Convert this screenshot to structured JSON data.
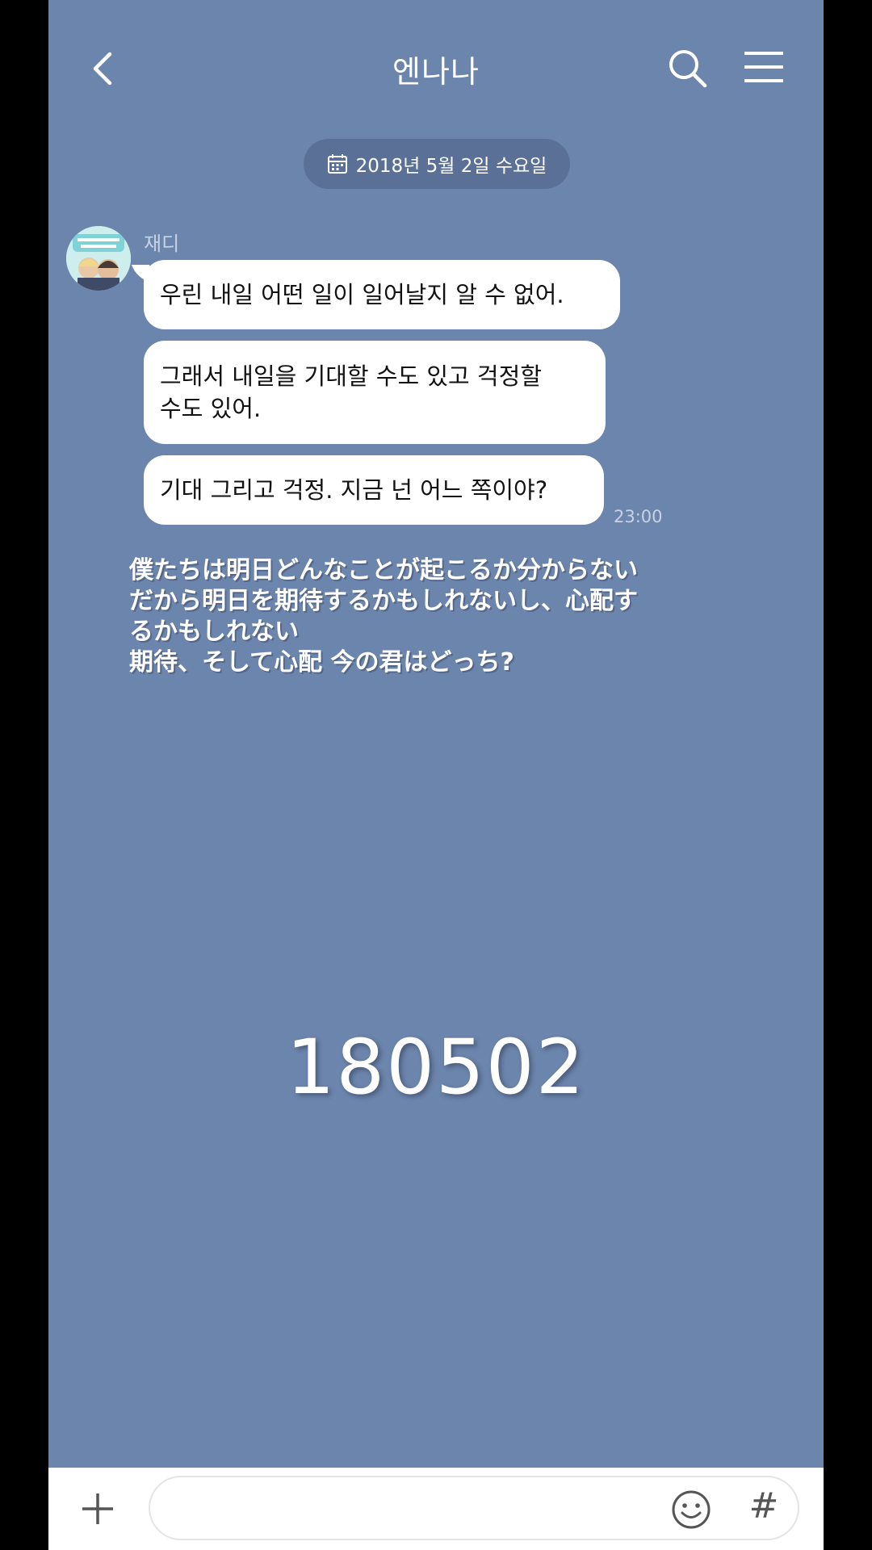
{
  "header": {
    "title": "엔나나",
    "back_icon": "chevron-left-icon",
    "search_icon": "search-icon",
    "menu_icon": "hamburger-menu-icon"
  },
  "date_separator": {
    "icon": "calendar-icon",
    "text": "2018년 5월 2일 수요일"
  },
  "messages": {
    "sender": "재디",
    "items": [
      {
        "text": "우린 내일 어떤 일이 일어날지 알 수 없어."
      },
      {
        "lines": [
          "그래서 내일을 기대할 수도 있고 걱정할",
          "수도 있어."
        ]
      },
      {
        "text": "기대 그리고 걱정. 지금 넌 어느 쪽이야?"
      }
    ],
    "time": "23:00"
  },
  "caption": {
    "lines": [
      "僕たちは明日どんなことが起こるか分からない",
      "だから明日を期待するかもしれないし、心配す",
      "るかもしれない",
      "期待、そして心配 今の君はどっち?"
    ]
  },
  "overlay_number": "180502",
  "input_bar": {
    "plus_icon": "plus-icon",
    "input_value": "",
    "emoji_icon": "smiley-icon",
    "hashtag_label": "#"
  },
  "colors": {
    "chat_background": "#6c85ac",
    "bubble": "#ffffff",
    "date_chip": "#5a7096"
  }
}
